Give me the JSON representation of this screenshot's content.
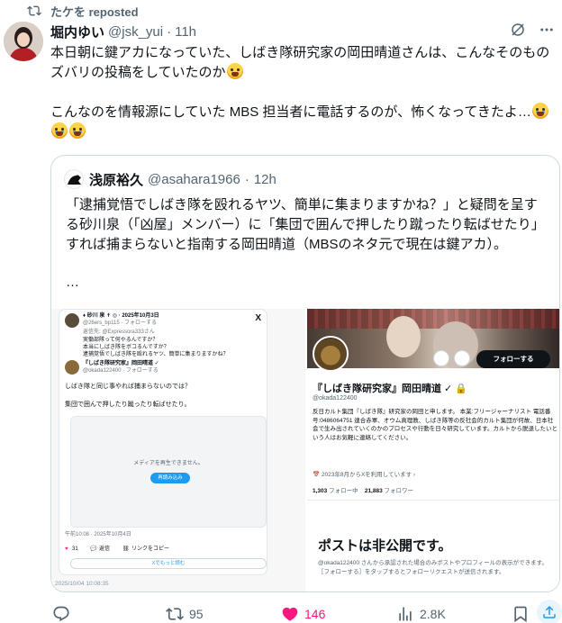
{
  "repost": {
    "label": "たケを reposted"
  },
  "tweet": {
    "author_name": "堀内ゆい",
    "author_handle": "@jsk_yui",
    "separator": "·",
    "time": "11h",
    "line1": "本日朝に鍵アカになっていた、しばき隊研究家の岡田晴道さんは、こんなそのものズバリの投稿をしていたのか",
    "line2": "こんなのを情報源にしていた MBS 担当者に電話するのが、怖くなってきたよ…"
  },
  "quote": {
    "author_name": "浅原裕久",
    "author_handle": "@asahara1966",
    "separator": "·",
    "time": "12h",
    "text": "「逮捕覚悟でしばき隊を殴れるヤツ、簡単に集まりますかね？」と疑問を呈する砂川泉（「凶屋」メンバー）に「集団で囲んで押したり蹴ったり転ばせたり」すれば捕まらないと指南する岡田晴道（MBSのネタ元で現在は鍵アカ）。",
    "ellipsis": "…"
  },
  "embed": {
    "x_logo": "X",
    "user1_name": "♦ 砂川 泉 ✝ ◎ · 2025年10月3日",
    "user1_handle": "@26ers_bp115 · フォローする",
    "user1_reply": "返信先: @Expressora333さん",
    "user1_l1": "実働部隊って何やるんですか？",
    "user1_l2": "本当にしばき隊をボコるんですか？",
    "user1_l3": "逮捕覚悟でしばき隊を殴れるヤツ、簡単に集まりますかね？",
    "user2_name": "『しばき隊研究家』岡田晴道 ✓",
    "user2_handle": "@okada122400 · フォローする",
    "user2_l1": "しばき隊と同じ事やれば捕まらないのでは？",
    "user2_l2": "集団で囲んで押したり蹴ったり転ばせたり。",
    "media_msg": "メディアを再生できません。",
    "media_btn": "再読み込み",
    "post_time": "午前10:08 · 2025年10月4日",
    "likes": "31",
    "reply": "返信",
    "copy_link": "リンクをコピー",
    "more": "Xでもっと読む",
    "stamp": "2025/10/04 10:08:35"
  },
  "profile": {
    "follow": "フォローする",
    "name": "『しばき隊研究家』岡田晴道 ✓ 🔒",
    "handle": "@okada122400",
    "bio": "反日カルト集団『しばき隊』研究家の岡田と申します。 本業:フリージャーナリスト 電話番号:0486064751 連合赤軍、オウム真理教、しばき隊等の反社会的カルト集団が何故、日本社会で生み出されていくのかのプロセスや行動を日々研究しています。カルトから脱退したいという人はお気軽に連絡してください。",
    "joined": "📅 2023年8月からXを利用しています ›",
    "following_count": "1,303",
    "following_label": "フォロー中",
    "followers_count": "21,883",
    "followers_label": "フォロワー",
    "private_title": "ポストは非公開です。",
    "private_sub": "@okada122400 さんから承認された場合のみポストやプロフィールの表示ができます。［フォローする］をタップするとフォローリクエストが送信されます。"
  },
  "actions": {
    "retweets": "95",
    "likes": "146",
    "views": "2.8K"
  },
  "colors": {
    "like": "#f91880",
    "accent": "#1d9bf0",
    "text": "#0f1419",
    "muted": "#536471"
  }
}
